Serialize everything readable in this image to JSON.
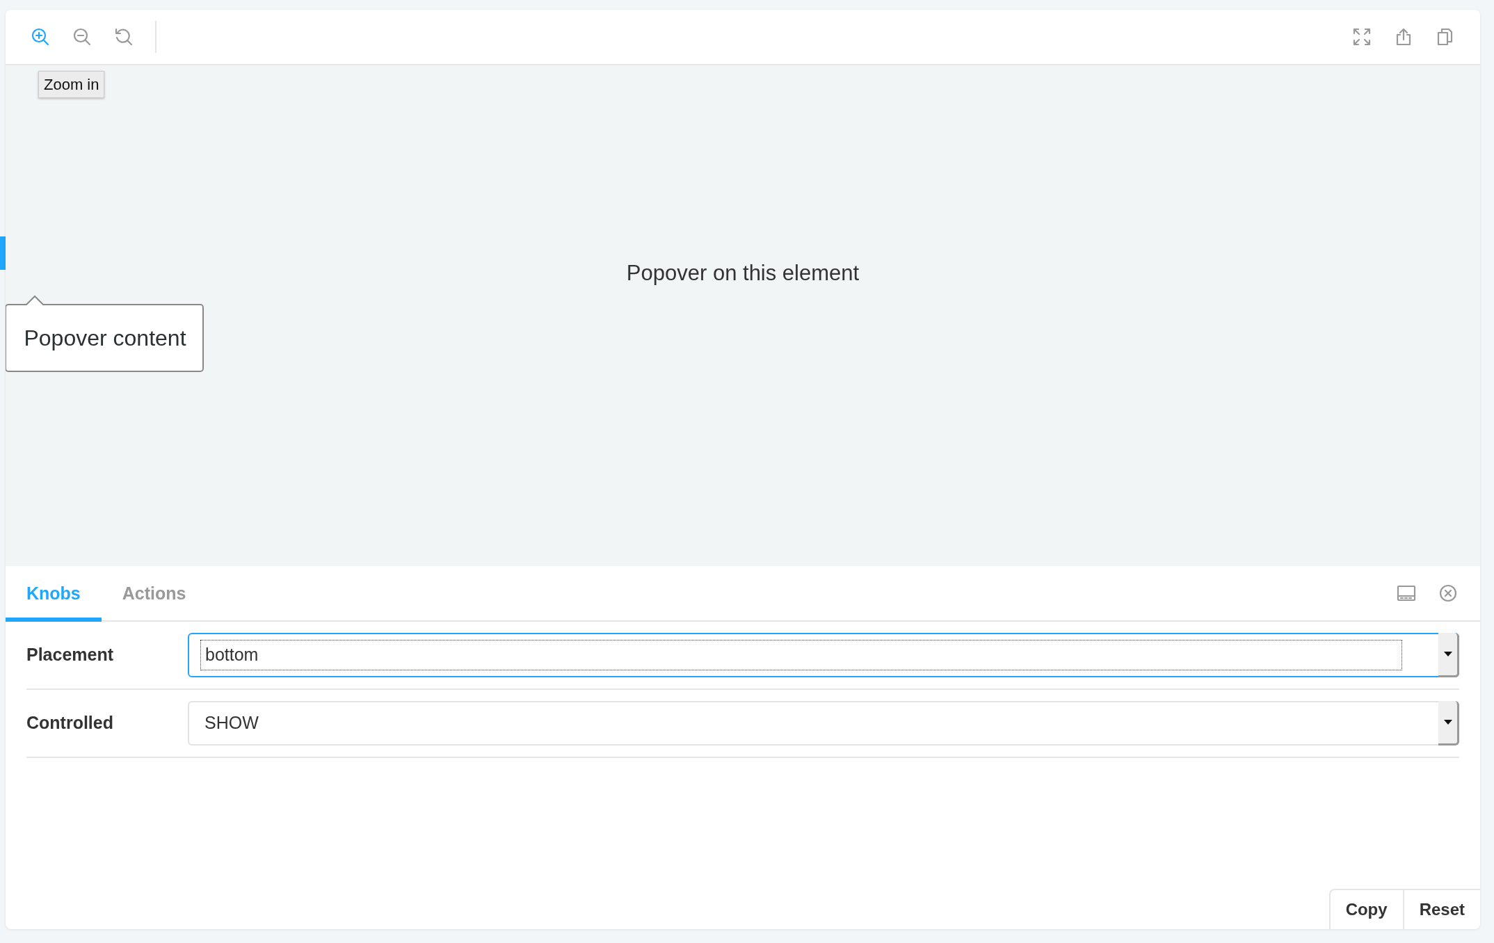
{
  "toolbar": {
    "left_tools": [
      {
        "kind": "zoom_in",
        "highlighted": true
      },
      {
        "kind": "zoom_out",
        "highlighted": false
      },
      {
        "kind": "reset_zoom",
        "highlighted": false
      }
    ],
    "right_tools": [
      {
        "kind": "fullscreen",
        "highlighted": false
      },
      {
        "kind": "share",
        "highlighted": false
      },
      {
        "kind": "copy",
        "highlighted": false
      }
    ],
    "tooltip": "Zoom in"
  },
  "preview": {
    "text": "Popover on this element",
    "popover": "Popover content"
  },
  "panel": {
    "tabs": [
      {
        "label": "Knobs",
        "selected": true
      },
      {
        "label": "Actions",
        "selected": false
      }
    ],
    "tools": [
      {
        "kind": "dock_bottom"
      },
      {
        "kind": "close"
      }
    ],
    "knobs": [
      {
        "label": "Placement",
        "kind": "select",
        "value": "bottom",
        "focused": true
      },
      {
        "label": "Controlled",
        "kind": "select",
        "value": "SHOW",
        "focused": false
      }
    ],
    "buttons": [
      "Copy",
      "Reset"
    ]
  }
}
